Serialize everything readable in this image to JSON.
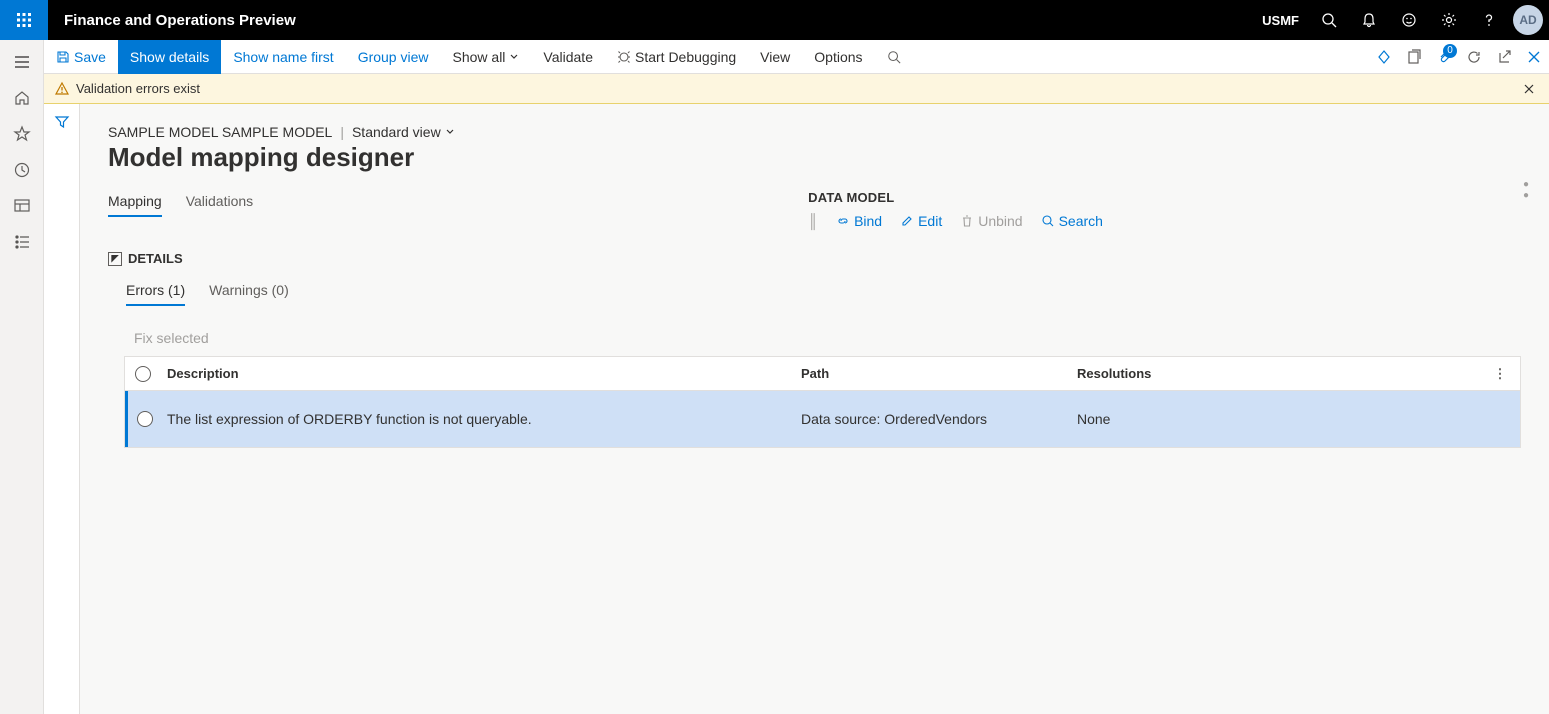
{
  "topbar": {
    "app_title": "Finance and Operations Preview",
    "company": "USMF",
    "avatar": "AD"
  },
  "actionbar": {
    "save": "Save",
    "show_details": "Show details",
    "show_name_first": "Show name first",
    "group_view": "Group view",
    "show_all": "Show all",
    "validate": "Validate",
    "start_debugging": "Start Debugging",
    "view": "View",
    "options": "Options",
    "badge_count": "0"
  },
  "banner": {
    "text": "Validation errors exist"
  },
  "crumbs": {
    "model": "SAMPLE MODEL SAMPLE MODEL",
    "view": "Standard view"
  },
  "page_title": "Model mapping designer",
  "tabs": {
    "mapping": "Mapping",
    "validations": "Validations"
  },
  "data_model": {
    "title": "DATA MODEL",
    "bind": "Bind",
    "edit": "Edit",
    "unbind": "Unbind",
    "search": "Search"
  },
  "details_header": "DETAILS",
  "subtabs": {
    "errors": "Errors (1)",
    "warnings": "Warnings (0)"
  },
  "fix_selected": "Fix selected",
  "grid": {
    "headers": {
      "description": "Description",
      "path": "Path",
      "resolutions": "Resolutions"
    },
    "rows": [
      {
        "description": "The list expression of ORDERBY function is not queryable.",
        "path": "Data source: OrderedVendors",
        "resolutions": "None"
      }
    ]
  }
}
